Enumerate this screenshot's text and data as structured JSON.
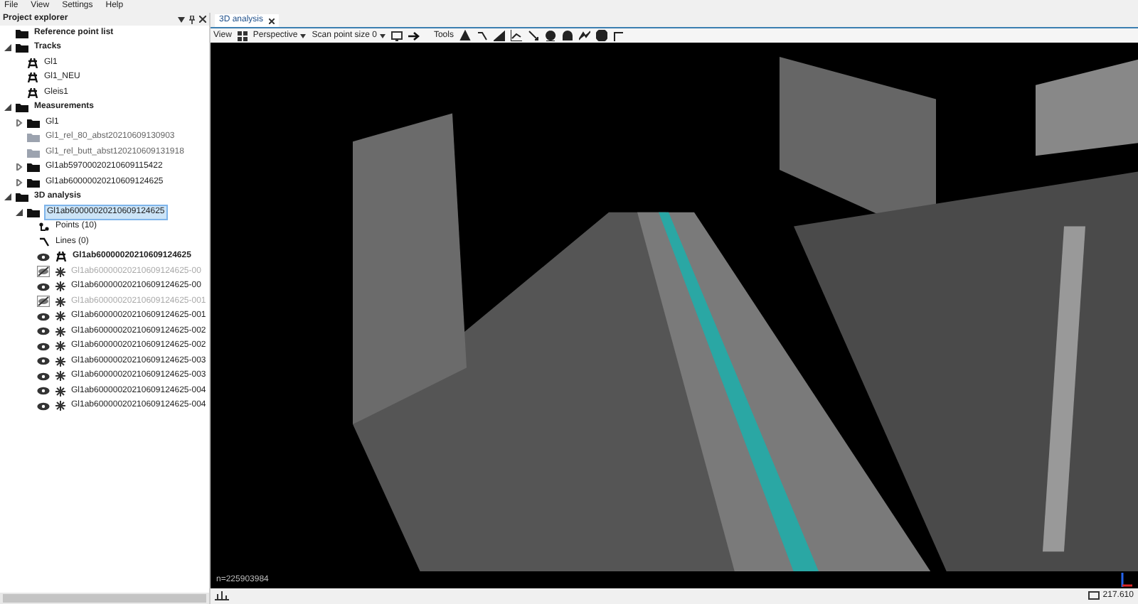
{
  "menu": [
    "File",
    "View",
    "Settings",
    "Help"
  ],
  "explorer": {
    "title": "Project explorer",
    "tree": [
      {
        "label": "Reference point list",
        "kind": "folder",
        "bold": true
      },
      {
        "label": "Tracks",
        "kind": "folder",
        "bold": true,
        "expanded": true,
        "children": [
          {
            "label": "Gl1",
            "kind": "track"
          },
          {
            "label": "Gl1_NEU",
            "kind": "track"
          },
          {
            "label": "Gleis1",
            "kind": "track"
          }
        ]
      },
      {
        "label": "Measurements",
        "kind": "folder",
        "bold": true,
        "expanded": true,
        "children": [
          {
            "label": "Gl1",
            "kind": "folder",
            "expanded": false
          },
          {
            "label": "Gl1_rel_80_abst20210609130903",
            "kind": "folder-grey"
          },
          {
            "label": "Gl1_rel_butt_abst120210609131918",
            "kind": "folder-grey"
          },
          {
            "label": "Gl1ab59700020210609115422",
            "kind": "folder",
            "expanded": false
          },
          {
            "label": "Gl1ab60000020210609124625",
            "kind": "folder",
            "expanded": false
          }
        ]
      },
      {
        "label": "3D analysis",
        "kind": "folder",
        "bold": true,
        "expanded": true,
        "children": [
          {
            "label": "Gl1ab60000020210609124625",
            "kind": "folder",
            "expanded": true,
            "selected": true,
            "children": [
              {
                "label": "Points (10)",
                "kind": "points"
              },
              {
                "label": "Lines (0)",
                "kind": "lines"
              }
            ]
          }
        ]
      }
    ],
    "layers": [
      {
        "label": "Gl1ab60000020210609124625",
        "kind": "track",
        "visible": true
      },
      {
        "label": "Gl1ab60000020210609124625-00",
        "kind": "point",
        "visible": false
      },
      {
        "label": "Gl1ab60000020210609124625-00",
        "kind": "point",
        "visible": true
      },
      {
        "label": "Gl1ab60000020210609124625-001",
        "kind": "point",
        "visible": false
      },
      {
        "label": "Gl1ab60000020210609124625-001",
        "kind": "point",
        "visible": true
      },
      {
        "label": "Gl1ab60000020210609124625-002",
        "kind": "point",
        "visible": true
      },
      {
        "label": "Gl1ab60000020210609124625-002",
        "kind": "point",
        "visible": true
      },
      {
        "label": "Gl1ab60000020210609124625-003",
        "kind": "point",
        "visible": true
      },
      {
        "label": "Gl1ab60000020210609124625-003",
        "kind": "point",
        "visible": true
      },
      {
        "label": "Gl1ab60000020210609124625-004",
        "kind": "point",
        "visible": true
      },
      {
        "label": "Gl1ab60000020210609124625-004",
        "kind": "point",
        "visible": true
      }
    ]
  },
  "tab": {
    "label": "3D analysis"
  },
  "toolbar": {
    "view_label": "View",
    "projection": "Perspective",
    "point_size": "Scan point size 0",
    "tools_label": "Tools"
  },
  "viewport": {
    "point_count": "n=225903984"
  },
  "status_bar": {
    "value": "217.610"
  }
}
